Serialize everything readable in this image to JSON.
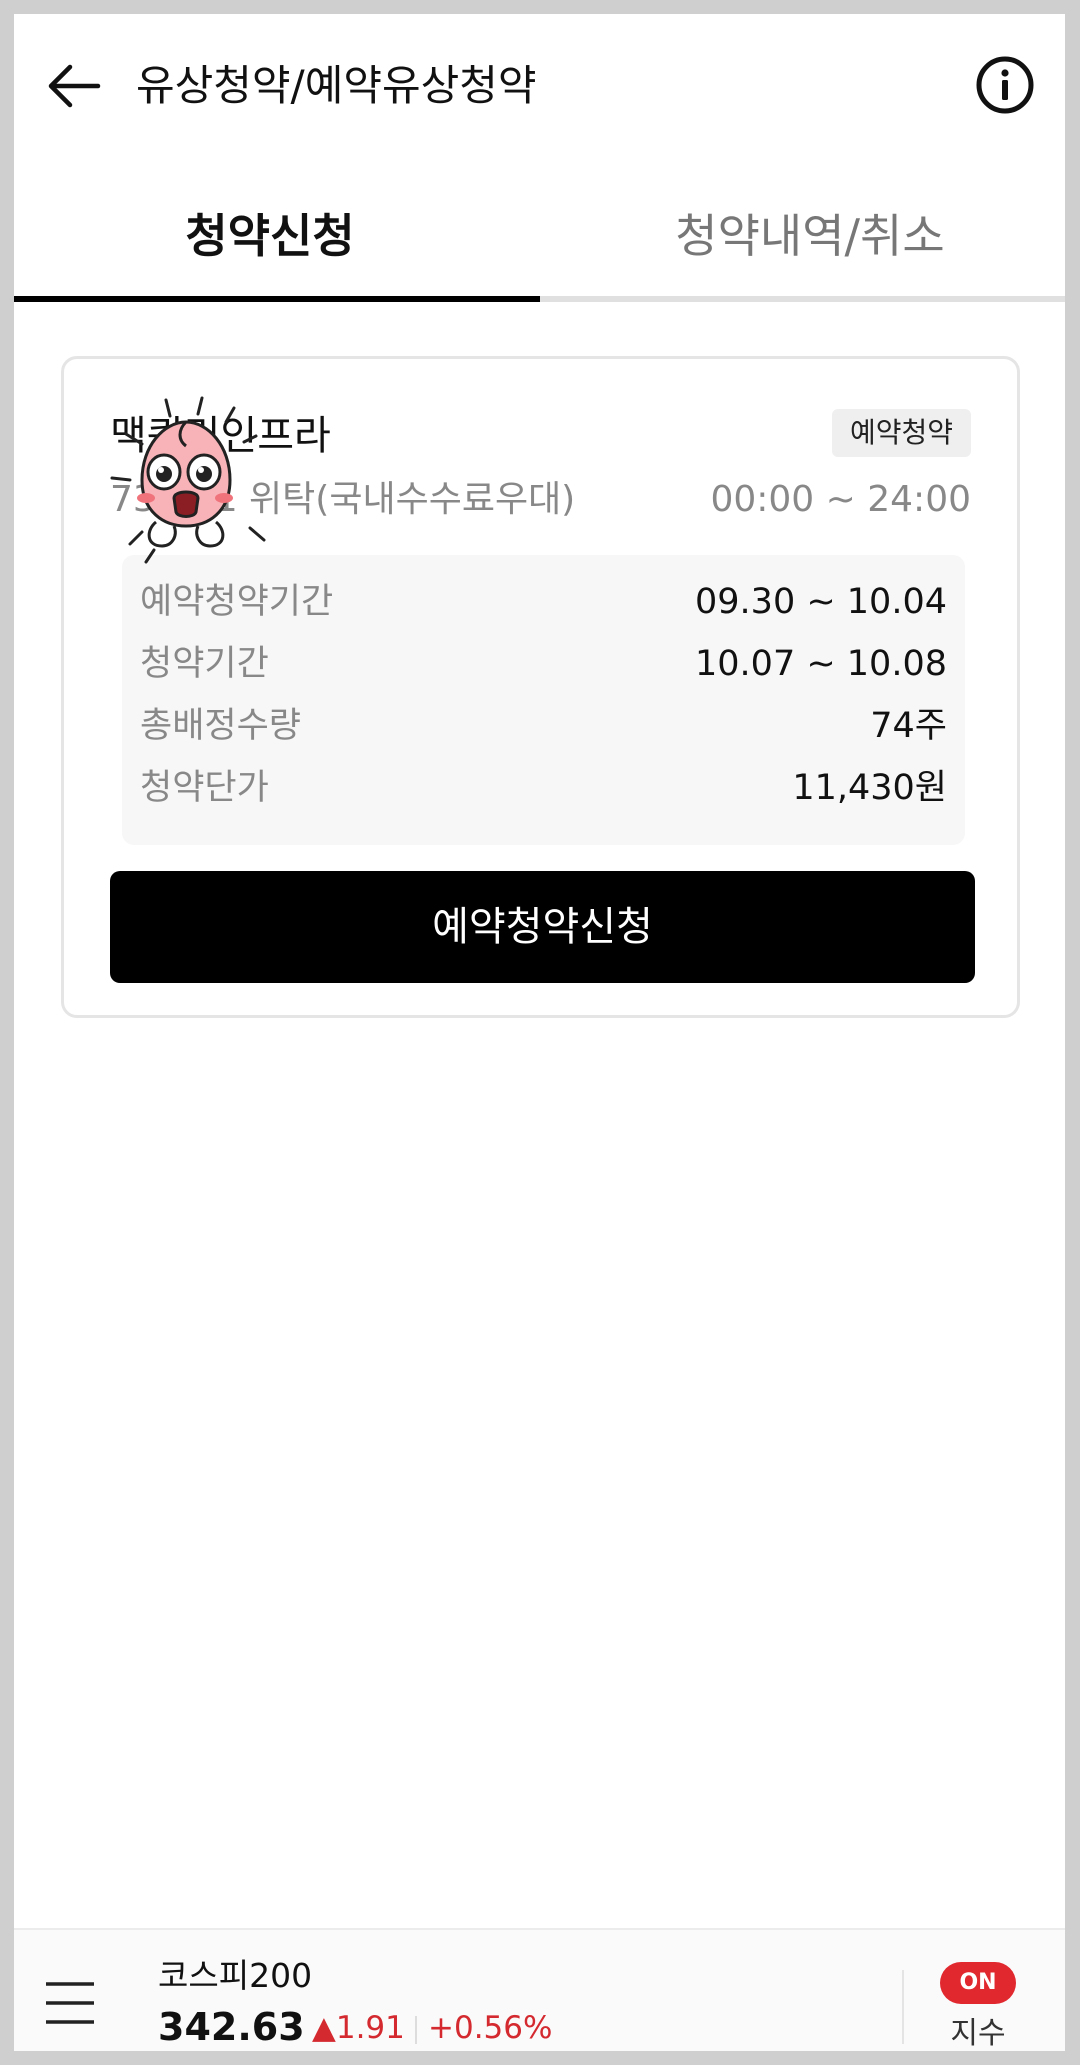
{
  "header": {
    "title": "유상청약/예약유상청약",
    "back_icon": "arrow-left-icon",
    "info_icon": "info-circle-icon"
  },
  "tabs": [
    {
      "label": "청약신청",
      "active": true
    },
    {
      "label": "청약내역/취소",
      "active": false
    }
  ],
  "card": {
    "stock_name": "맥쿼리인프라",
    "badge": "예약청약",
    "account": "73…01 위탁(국내수수료우대)",
    "hours": "00:00 ~ 24:00",
    "rows": [
      {
        "label": "예약청약기간",
        "value": "09.30 ~ 10.04"
      },
      {
        "label": "청약기간",
        "value": "10.07 ~ 10.08"
      },
      {
        "label": "총배정수량",
        "value": "74주"
      },
      {
        "label": "청약단가",
        "value": "11,430원"
      }
    ],
    "apply_button": "예약청약신청"
  },
  "bottom_bar": {
    "index_name": "코스피200",
    "index_value": "342.63",
    "index_change": "▲1.91",
    "index_change_pct": "+0.56%",
    "on_badge": "ON",
    "on_label": "지수",
    "menu_icon": "hamburger-menu-icon"
  },
  "colors": {
    "accent_black": "#000000",
    "up_red": "#d3292f",
    "on_badge_red": "#e0282e"
  }
}
